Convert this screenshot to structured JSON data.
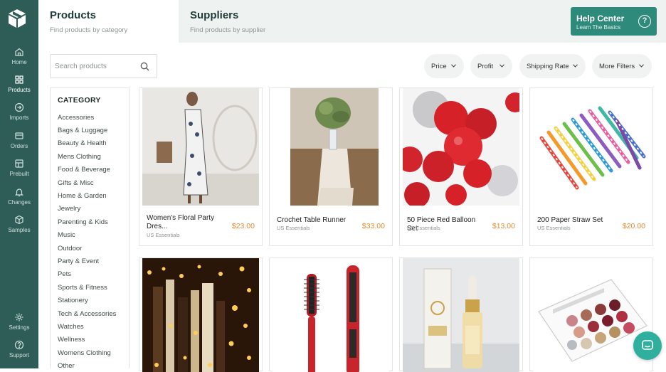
{
  "sidebar": {
    "items": [
      {
        "label": "Home",
        "icon": "home-icon"
      },
      {
        "label": "Products",
        "icon": "grid-icon"
      },
      {
        "label": "Imports",
        "icon": "import-icon"
      },
      {
        "label": "Orders",
        "icon": "orders-icon"
      },
      {
        "label": "Prebuilt",
        "icon": "prebuilt-icon"
      },
      {
        "label": "Changes",
        "icon": "bell-icon"
      },
      {
        "label": "Samples",
        "icon": "box-icon"
      }
    ],
    "bottom_items": [
      {
        "label": "Settings",
        "icon": "gear-icon"
      },
      {
        "label": "Support",
        "icon": "help-icon"
      }
    ],
    "active": "Products"
  },
  "tabs": [
    {
      "title": "Products",
      "subtitle": "Find products by category"
    },
    {
      "title": "Suppliers",
      "subtitle": "Find products by supplier"
    }
  ],
  "help": {
    "title": "Help Center",
    "subtitle": "Learn The Basics"
  },
  "search": {
    "placeholder": "Search products"
  },
  "filters": [
    "Price",
    "Profit",
    "Shipping Rate",
    "More Filters"
  ],
  "categories": {
    "title": "CATEGORY",
    "items": [
      "Accessories",
      "Bags & Luggage",
      "Beauty & Health",
      "Mens Clothing",
      "Food & Beverage",
      "Gifts & Misc",
      "Home & Garden",
      "Jewelry",
      "Parenting & Kids",
      "Music",
      "Outdoor",
      "Party & Event",
      "Pets",
      "Sports & Fitness",
      "Stationery",
      "Tech & Accessories",
      "Watches",
      "Wellness",
      "Womens Clothing",
      "Other"
    ]
  },
  "products": [
    {
      "name": "Women's Floral Party Dres...",
      "supplier": "US Essentials",
      "price": "$23.00"
    },
    {
      "name": "Crochet Table Runner",
      "supplier": "US Essentials",
      "price": "$33.00"
    },
    {
      "name": "50 Piece Red Balloon Set",
      "supplier": "US Essentials",
      "price": "$13.00"
    },
    {
      "name": "200 Paper Straw Set",
      "supplier": "US Essentials",
      "price": "$20.00"
    }
  ],
  "colors": {
    "sidebar": "#2e5d57",
    "accent": "#2e8a7b",
    "price": "#e08a2c",
    "chat": "#2fb09e"
  }
}
